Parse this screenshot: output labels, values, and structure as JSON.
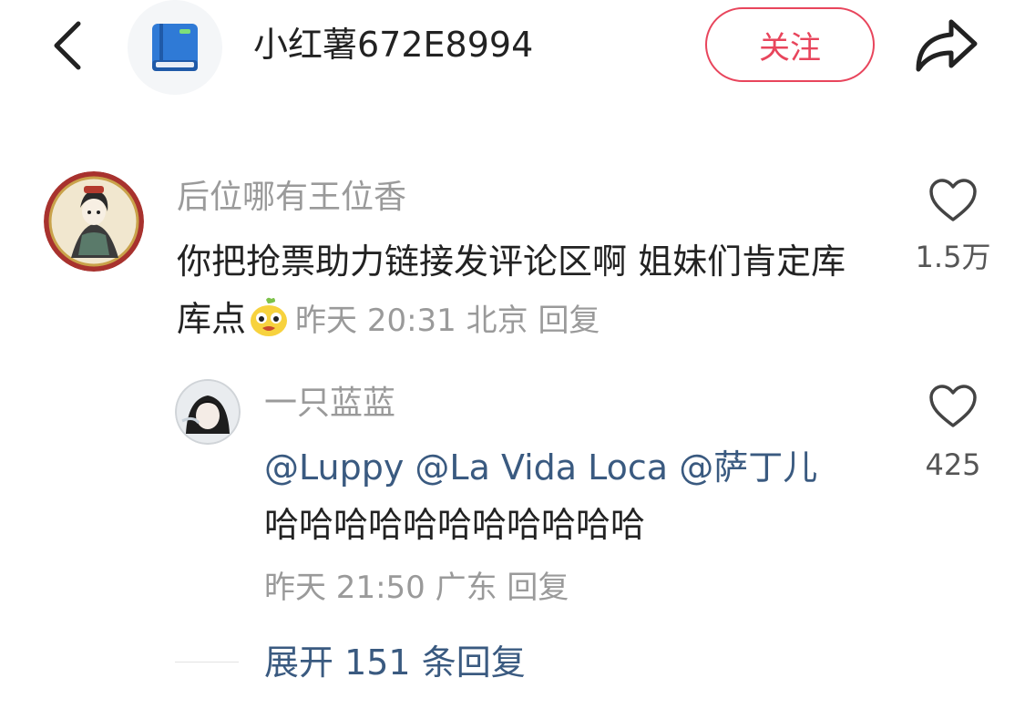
{
  "header": {
    "author_name": "小红薯672E8994",
    "follow_label": "关注",
    "icons": [
      "back-icon",
      "notebook-icon",
      "share-icon"
    ],
    "accent_color": "#e8455c"
  },
  "comment": {
    "username": "后位哪有王位香",
    "text": "你把抢票助力链接发评论区啊 姐妹们肯定库库点",
    "emoji": "emoji-sticker-icon",
    "time": "昨天 20:31",
    "location": "北京",
    "reply_label": "回复",
    "likes": "1.5万"
  },
  "reply": {
    "username": "一只蓝蓝",
    "mentions": [
      "@Luppy",
      "@La Vida Loca",
      "@萨丁儿"
    ],
    "text": "哈哈哈哈哈哈哈哈哈哈哈",
    "time": "昨天 21:50",
    "location": "广东",
    "reply_label": "回复",
    "likes": "425",
    "mention_color": "#3a5a80"
  },
  "expand": {
    "label": "展开 151 条回复"
  }
}
